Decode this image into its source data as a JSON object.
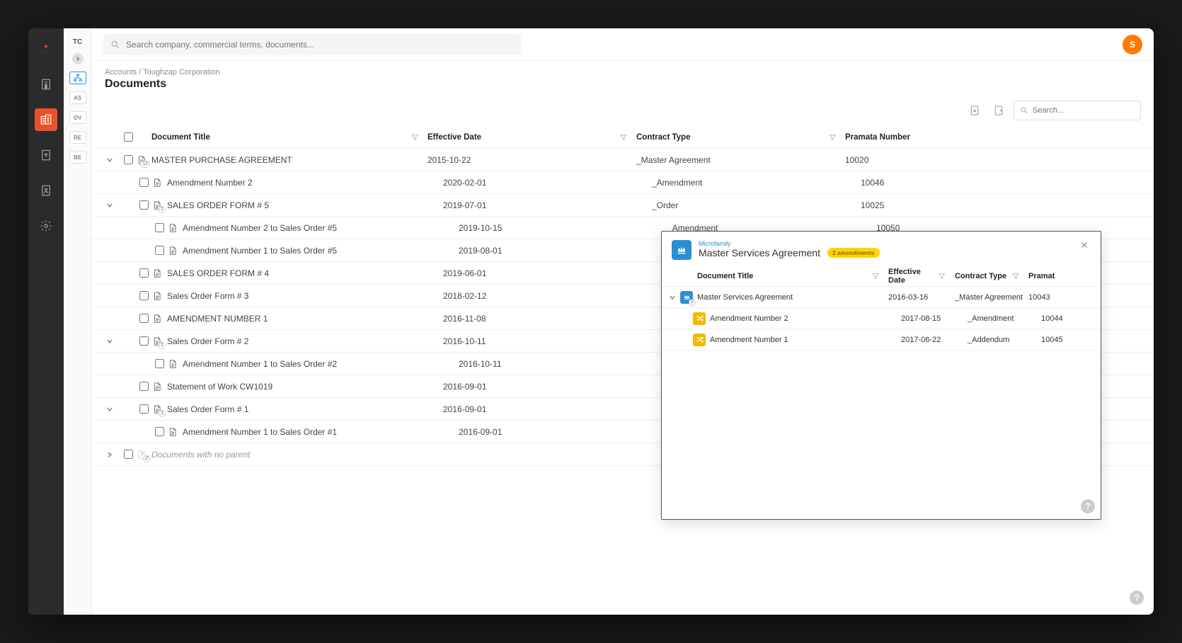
{
  "rail_title": "TC",
  "rail_chips": [
    "AS",
    "OV",
    "RE",
    "BE"
  ],
  "global_search_placeholder": "Search company, commercial terms, documents...",
  "avatar_initial": "S",
  "breadcrumb": "Accounts / Toughzap Corporation",
  "page_title": "Documents",
  "local_search_placeholder": "Search...",
  "columns": {
    "title": "Document Title",
    "date": "Effective Date",
    "type": "Contract Type",
    "pnum": "Pramata Number"
  },
  "rows": [
    {
      "indent": 1,
      "expander": "down",
      "badge": "12",
      "title": "MASTER PURCHASE AGREEMENT",
      "date": "2015-10-22",
      "type": "_Master Agreement",
      "pnum": "10020"
    },
    {
      "indent": 2,
      "title": "Amendment Number 2",
      "date": "2020-02-01",
      "type": "_Amendment",
      "pnum": "10046"
    },
    {
      "indent": 2,
      "expander": "down",
      "badge": "2",
      "title": "SALES ORDER FORM # 5",
      "date": "2019-07-01",
      "type": "_Order",
      "pnum": "10025"
    },
    {
      "indent": 3,
      "title": "Amendment Number 2 to Sales Order #5",
      "date": "2019-10-15",
      "type": "_Amendment",
      "pnum": "10050"
    },
    {
      "indent": 3,
      "title": "Amendment Number 1 to Sales Order #5",
      "date": "2019-08-01",
      "type": "",
      "pnum": ""
    },
    {
      "indent": 2,
      "title": "SALES ORDER FORM # 4",
      "date": "2019-06-01",
      "type": "",
      "pnum": ""
    },
    {
      "indent": 2,
      "title": "Sales Order Form # 3",
      "date": "2018-02-12",
      "type": "",
      "pnum": ""
    },
    {
      "indent": 2,
      "title": "AMENDMENT NUMBER 1",
      "date": "2016-11-08",
      "type": "",
      "pnum": ""
    },
    {
      "indent": 2,
      "expander": "down",
      "badge": "1",
      "title": "Sales Order Form # 2",
      "date": "2016-10-11",
      "type": "",
      "pnum": ""
    },
    {
      "indent": 3,
      "title": "Amendment Number 1 to Sales Order #2",
      "date": "2016-10-11",
      "type": "",
      "pnum": ""
    },
    {
      "indent": 2,
      "title": "Statement of Work CW1019",
      "date": "2016-09-01",
      "type": "",
      "pnum": ""
    },
    {
      "indent": 2,
      "expander": "down",
      "badge": "1",
      "title": "Sales Order Form # 1",
      "date": "2016-09-01",
      "type": "",
      "pnum": ""
    },
    {
      "indent": 3,
      "title": "Amendment Number 1 to Sales Order #1",
      "date": "2016-09-01",
      "type": "",
      "pnum": ""
    }
  ],
  "no_parent": {
    "badge": "2",
    "label": "Documents with no parent"
  },
  "panel": {
    "overline": "Microfamily",
    "title": "Master Services Agreement",
    "badge": "2 amendments",
    "columns": {
      "title": "Document Title",
      "date": "Effective Date",
      "type": "Contract Type",
      "pnum": "Pramat"
    },
    "rows": [
      {
        "indent": 1,
        "expander": "down",
        "icon": "blue",
        "badge": "2",
        "title": "Master Services Agreement",
        "date": "2016-03-16",
        "type": "_Master Agreement",
        "pnum": "10043"
      },
      {
        "indent": 2,
        "icon": "gold",
        "title": "Amendment Number 2",
        "date": "2017-08-15",
        "type": "_Amendment",
        "pnum": "10044"
      },
      {
        "indent": 2,
        "icon": "gold",
        "title": "Amendment Number 1",
        "date": "2017-06-22",
        "type": "_Addendum",
        "pnum": "10045"
      }
    ]
  }
}
